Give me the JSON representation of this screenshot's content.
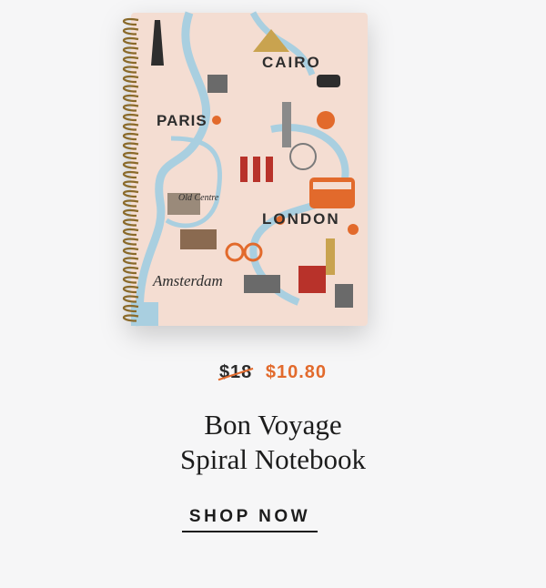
{
  "product": {
    "image_icon": "spiral-notebook-map-illustration",
    "map_labels": [
      "CAIRO",
      "PARIS",
      "LONDON",
      "Amsterdam",
      "Old Centre"
    ],
    "price_original": "$18",
    "price_sale": "$10.80",
    "title_line1": "Bon Voyage",
    "title_line2": "Spiral Notebook"
  },
  "cta": {
    "label": "SHOP NOW"
  },
  "colors": {
    "accent": "#e26a2c",
    "text": "#1c1c1c",
    "background": "#f6f6f7",
    "cover": "#f4ddd2",
    "water": "#a9cfe0"
  }
}
